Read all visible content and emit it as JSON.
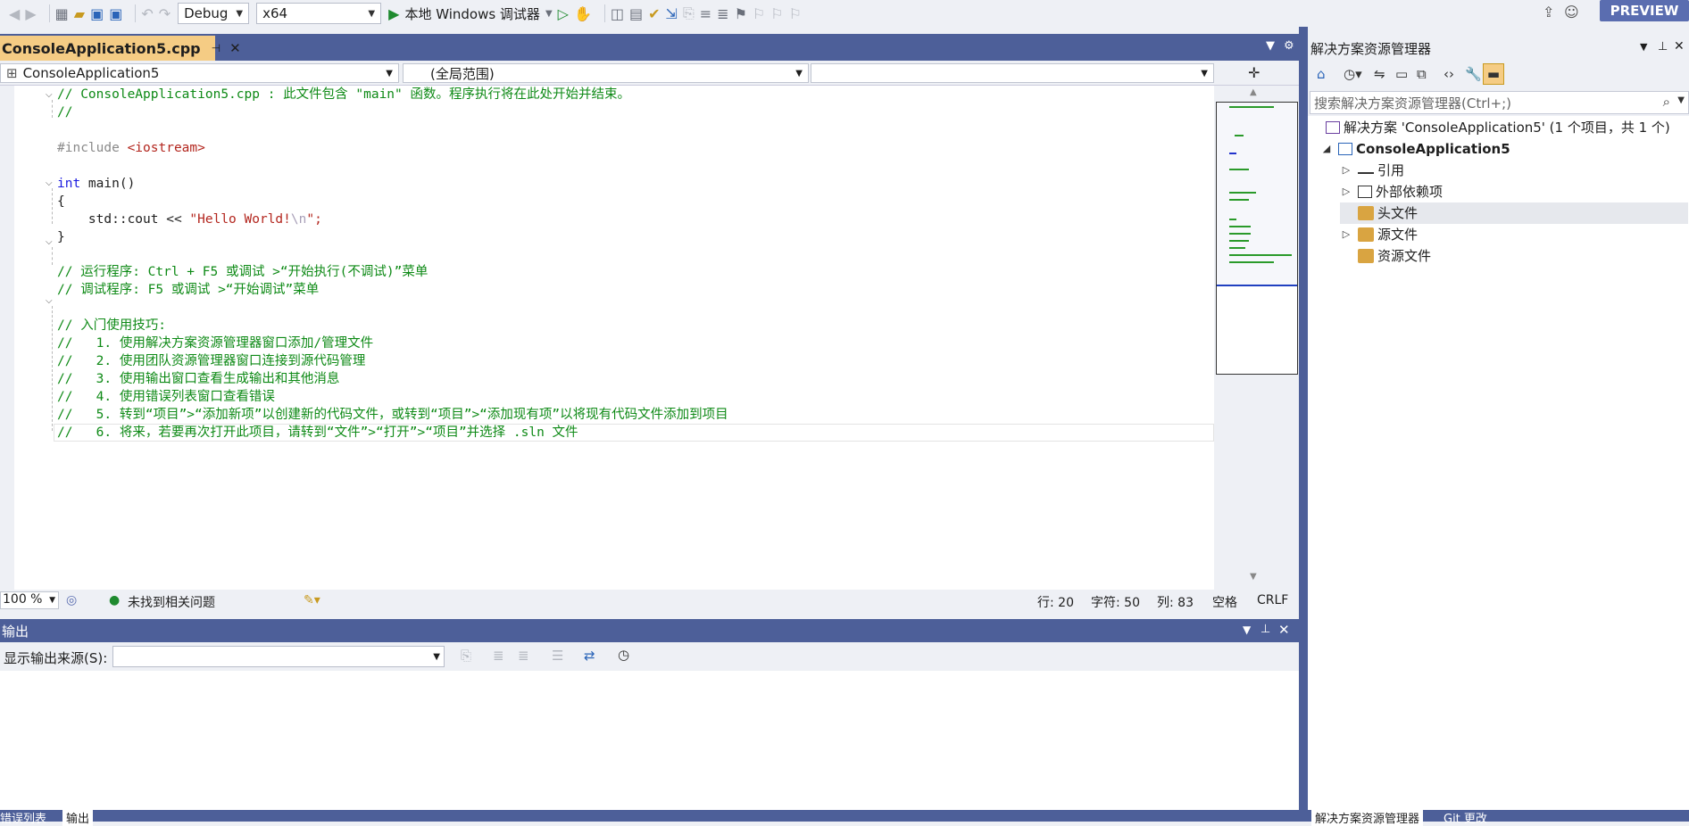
{
  "toolbar": {
    "config": "Debug",
    "platform": "x64",
    "run_label": "本地 Windows 调试器",
    "preview": "PREVIEW"
  },
  "editor": {
    "tab_title": "ConsoleApplication5.cpp",
    "nav_project": "ConsoleApplication5",
    "nav_scope": "(全局范围)",
    "nav_member": "",
    "lines": {
      "l1": "// ConsoleApplication5.cpp : 此文件包含 \"main\" 函数。程序执行将在此处开始并结束。",
      "l2": "//",
      "l4a": "#include ",
      "l4b": "<iostream>",
      "l6a": "int ",
      "l6b": "main()",
      "l7": "{",
      "l8a": "    std::cout << ",
      "l8b": "\"Hello World!",
      "l8c": "\\n",
      "l8d": "\";",
      "l9": "}",
      "l11": "// 运行程序: Ctrl + F5 或调试 >“开始执行(不调试)”菜单",
      "l12": "// 调试程序: F5 或调试 >“开始调试”菜单",
      "l14": "// 入门使用技巧:",
      "l15": "//   1. 使用解决方案资源管理器窗口添加/管理文件",
      "l16": "//   2. 使用团队资源管理器窗口连接到源代码管理",
      "l17": "//   3. 使用输出窗口查看生成输出和其他消息",
      "l18": "//   4. 使用错误列表窗口查看错误",
      "l19": "//   5. 转到“项目”>“添加新项”以创建新的代码文件，或转到“项目”>“添加现有项”以将现有代码文件添加到项目",
      "l20": "//   6. 将来，若要再次打开此项目，请转到“文件”>“打开”>“项目”并选择 .sln 文件"
    }
  },
  "status": {
    "zoom": "100 %",
    "issues": "未找到相关问题",
    "line": "行: 20",
    "char": "字符: 50",
    "col": "列: 83",
    "whitespace": "空格",
    "eol": "CRLF"
  },
  "output": {
    "title": "输出",
    "source_label": "显示输出来源(S):",
    "source_value": ""
  },
  "bottom_tabs": [
    "错误列表",
    "输出"
  ],
  "solution_explorer": {
    "title": "解决方案资源管理器",
    "search_placeholder": "搜索解决方案资源管理器(Ctrl+;)",
    "solution_label": "解决方案 'ConsoleApplication5' (1 个项目，共 1 个)",
    "project": "ConsoleApplication5",
    "items": [
      "引用",
      "外部依赖项",
      "头文件",
      "源文件",
      "资源文件"
    ],
    "bottom_tabs": [
      "解决方案资源管理器",
      "Git 更改"
    ]
  },
  "colors": {
    "accent": "#4d5f99",
    "tab_active": "#f5cc84",
    "comment": "#0e8a16",
    "keyword": "#1a1ae0",
    "string": "#b3261e"
  }
}
